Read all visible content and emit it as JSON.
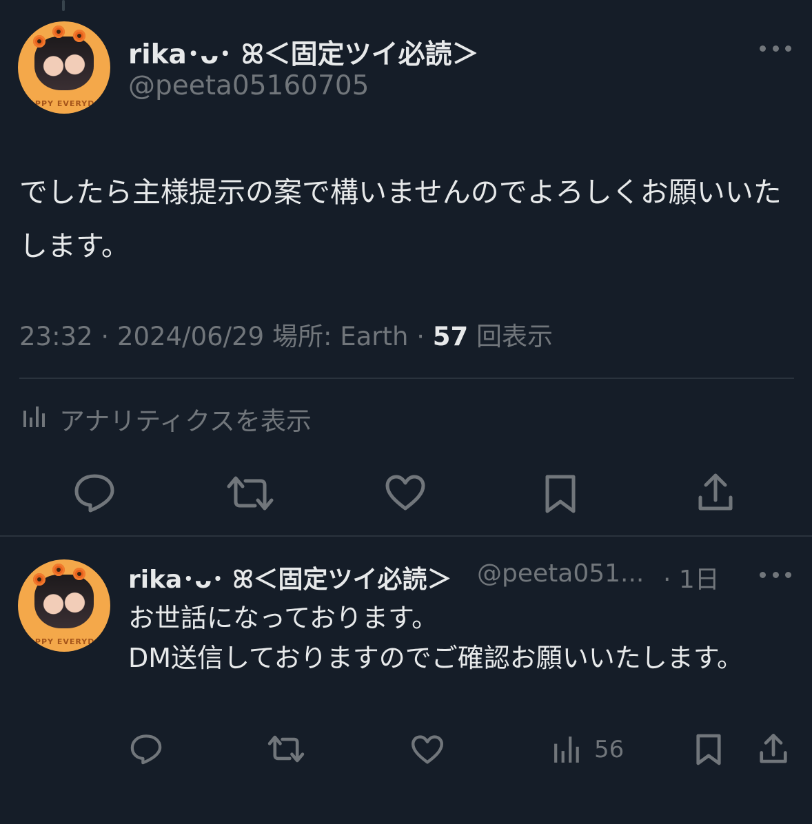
{
  "main_tweet": {
    "author_name": "rika･ᴗ･ ꕤ＜固定ツイ必読＞",
    "handle": "@peeta05160705",
    "text": "でしたら主様提示の案で構いませんのでよろしくお願いいたします。",
    "time": "23:32",
    "date": "2024/06/29",
    "location": "場所: Earth",
    "views_count": "57",
    "views_label": "回表示",
    "analytics_label": "アナリティクスを表示",
    "avatar_text": "HAPPY EVERYDAY"
  },
  "reply_tweet": {
    "author_name": "rika･ᴗ･ ꕤ＜固定ツイ必読＞",
    "handle": "@peeta051...",
    "time_ago": "· 1日",
    "text": "お世話になっております。\nDM送信しておりますのでご確認お願いいたします。",
    "views_count": "56",
    "avatar_text": "HAPPY EVERYDAY"
  },
  "colors": {
    "background": "#151d28",
    "text_primary": "#e7e9ea",
    "text_secondary": "#71767b",
    "avatar_bg": "#f4a84a",
    "divider": "#2a333d"
  },
  "icons": [
    "more-icon",
    "analytics-icon",
    "reply-icon",
    "retweet-icon",
    "like-icon",
    "bookmark-icon",
    "share-icon"
  ]
}
